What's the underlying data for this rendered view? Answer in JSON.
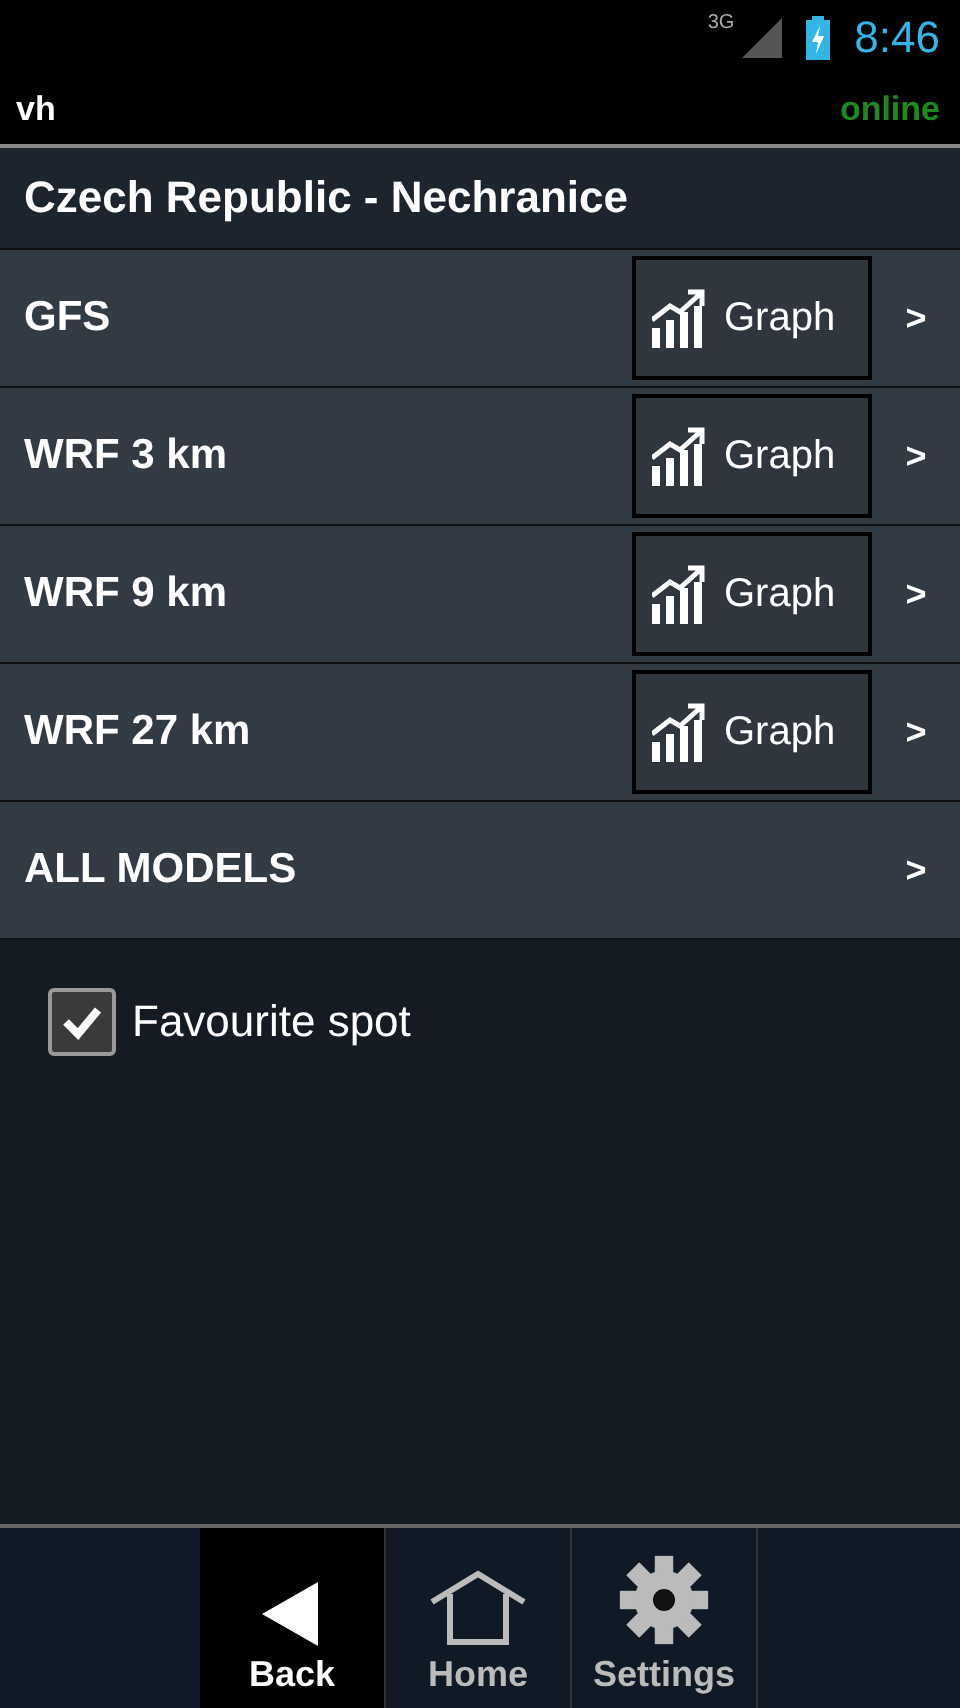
{
  "status_bar": {
    "network": "3G",
    "time": "8:46"
  },
  "app_bar": {
    "title": "vh",
    "connection": "online"
  },
  "header": {
    "title": "Czech Republic - Nechranice"
  },
  "models": [
    {
      "kind": "model",
      "name": "GFS",
      "graph": "Graph",
      "arrow": ">"
    },
    {
      "kind": "model",
      "name": "WRF 3 km",
      "graph": "Graph",
      "arrow": ">"
    },
    {
      "kind": "model",
      "name": "WRF 9 km",
      "graph": "Graph",
      "arrow": ">"
    },
    {
      "kind": "model",
      "name": "WRF 27 km",
      "graph": "Graph",
      "arrow": ">"
    },
    {
      "kind": "all",
      "name": "ALL MODELS",
      "arrow": ">"
    }
  ],
  "favourite": {
    "label": "Favourite spot",
    "checked": true
  },
  "nav": [
    {
      "kind": "back",
      "label": "Back",
      "selected": true
    },
    {
      "kind": "home",
      "label": "Home",
      "selected": false
    },
    {
      "kind": "settings",
      "label": "Settings",
      "selected": false
    }
  ]
}
